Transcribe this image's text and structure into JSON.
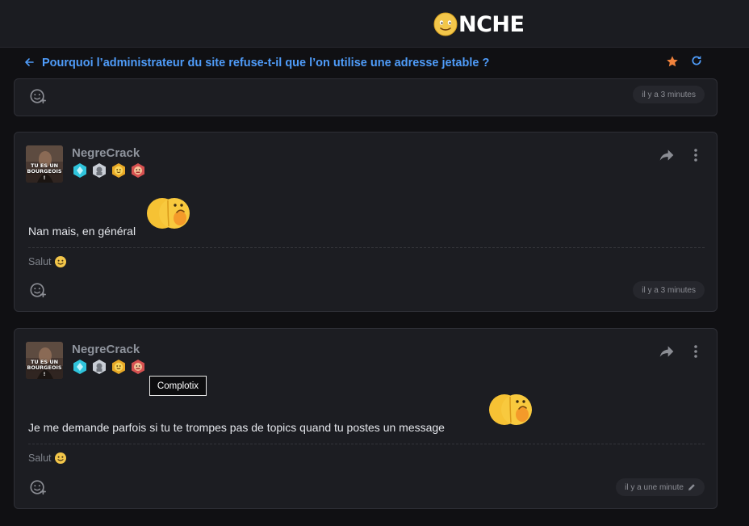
{
  "header": {
    "logo_text": "NCHE",
    "logo_icon": "onche-smiley-icon"
  },
  "topic": {
    "title": "Pourquoi l’administrateur du site refuse-t-il que l’on utilise une adresse jetable ?",
    "back_icon": "arrow-left-icon",
    "favorite_icon": "star-icon",
    "refresh_icon": "refresh-icon"
  },
  "posts": [
    {
      "time": "il y a 3 minutes"
    },
    {
      "author": "NegreCrack",
      "avatar_caption": "TU ES UN BOURGEOIS !",
      "badges": [
        "diamond-badge-icon",
        "silver-badge-icon",
        "gold-smiley-badge-icon",
        "red-badge-icon"
      ],
      "message": "Nan mais, en général",
      "signature": "Salut",
      "time": "il y a 3 minutes"
    },
    {
      "author": "NegreCrack",
      "avatar_caption": "TU ES UN BOURGEOIS !",
      "badges": [
        "diamond-badge-icon",
        "silver-badge-icon",
        "gold-smiley-badge-icon",
        "red-badge-icon"
      ],
      "message": "Je me demande parfois si tu te trompes pas de topics quand tu postes un message",
      "signature": "Salut",
      "time": "il y a une minute",
      "edited_icon": "pencil-icon"
    }
  ],
  "tooltip": {
    "text": "Complotix"
  },
  "colors": {
    "accent": "#4f9cf9",
    "star": "#f0823c",
    "background": "#101013",
    "card": "#1c1d22"
  }
}
